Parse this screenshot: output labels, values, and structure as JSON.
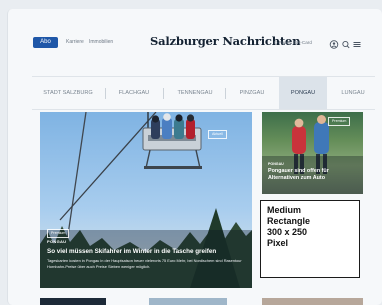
{
  "header": {
    "abo_label": "Abo",
    "top_links": [
      "Karriere",
      "Immobilien"
    ],
    "logo": "Salzburger Nachrichten",
    "right_links": [
      "E-Paper",
      "SN-Card"
    ],
    "icons": [
      "user-icon",
      "search-icon",
      "menu-icon"
    ]
  },
  "nav": {
    "tabs": [
      "STADT SALZBURG",
      "FLACHGAU",
      "TENNENGAU",
      "PINZGAU",
      "PONGAU",
      "LUNGAU"
    ],
    "active": "PONGAU"
  },
  "hero": {
    "kicker": "PONGAU",
    "title": "So viel müssen Skifahrer im Winter in die Tasche greifen",
    "text": "Tageskarten kosten in Pongau in der Hauptsaison heuer vielerorts 75 Euro Mehr, bei Nordischem sind Rasentour Hornbahn-Preise über auch Preise Sieben weniger möglich.",
    "badges": [
      "Aktuell",
      "Premium"
    ]
  },
  "side_article": {
    "kicker": "PONGAU",
    "title": "Pongauer sind offen für Alternativen zum Auto",
    "badge": "Premium"
  },
  "ad": {
    "text": "Medium\nRectangle\n300 x 250\nPixel"
  },
  "colors": {
    "brand": "#1f57a8",
    "page_bg": "#f6f8fa",
    "active_tab_bg": "#dce3ea"
  }
}
